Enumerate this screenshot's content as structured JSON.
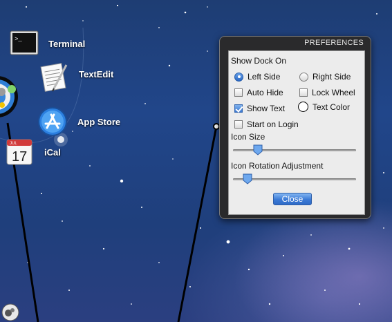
{
  "dock": {
    "items": [
      {
        "label": "Terminal",
        "icon": "terminal-icon"
      },
      {
        "label": "TextEdit",
        "icon": "textedit-icon"
      },
      {
        "label": "App Store",
        "icon": "app-store-icon"
      },
      {
        "label": "iCal",
        "icon": "ical-icon"
      }
    ],
    "ical_month": "JUL",
    "ical_day": "17"
  },
  "preferences": {
    "title": "PREFERENCES",
    "show_dock_on_label": "Show Dock On",
    "left_side": {
      "label": "Left Side",
      "selected": true
    },
    "right_side": {
      "label": "Right Side",
      "selected": false
    },
    "auto_hide": {
      "label": "Auto Hide",
      "checked": false
    },
    "lock_wheel": {
      "label": "Lock Wheel",
      "checked": false
    },
    "show_text": {
      "label": "Show Text",
      "checked": true
    },
    "text_color": {
      "label": "Text Color",
      "color": "#ffffff"
    },
    "start_on_login": {
      "label": "Start on Login",
      "checked": false
    },
    "icon_size": {
      "label": "Icon Size",
      "value": 0.2
    },
    "icon_rotation": {
      "label": "Icon Rotation Adjustment",
      "value": 0.12
    },
    "close_label": "Close"
  },
  "colors": {
    "desktop": "#21468a",
    "panel_frame": "#2a2a2c",
    "panel_body": "#ececec",
    "accent": "#3b7ad6"
  }
}
